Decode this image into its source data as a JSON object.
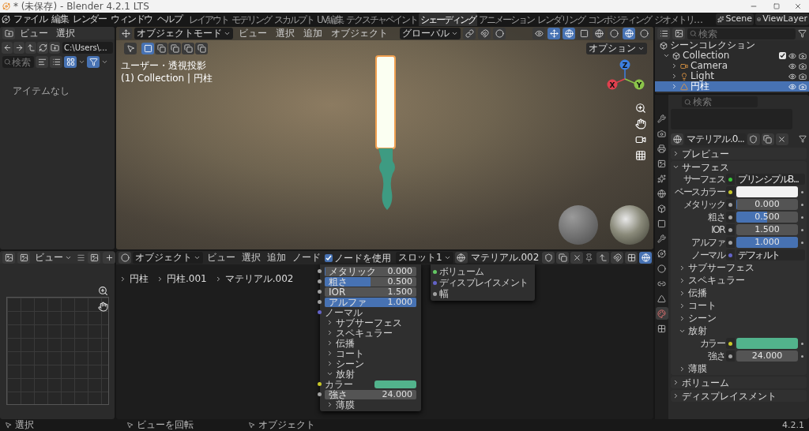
{
  "window": {
    "title": "* (未保存) - Blender 4.2.1 LTS"
  },
  "menubar": {
    "menus": [
      "ファイル",
      "編集",
      "レンダー",
      "ウィンドウ",
      "ヘルプ"
    ],
    "workspaces": [
      {
        "label": "レイアウト",
        "selected": false
      },
      {
        "label": "モデリング",
        "selected": false
      },
      {
        "label": "スカルプト",
        "selected": false
      },
      {
        "label": "UV編集",
        "selected": false
      },
      {
        "label": "テクスチャペイント",
        "selected": false
      },
      {
        "label": "シェーディング",
        "selected": true
      },
      {
        "label": "アニメーション",
        "selected": false
      },
      {
        "label": "レンダリング",
        "selected": false
      },
      {
        "label": "コンポジティング",
        "selected": false
      },
      {
        "label": "ジオメトリ…",
        "selected": false
      }
    ],
    "scene": "Scene",
    "view_layer": "ViewLayer"
  },
  "file_browser": {
    "menus": [
      "ビュー",
      "選択"
    ],
    "path": "C:\\Users\\...",
    "search_placeholder": "検索",
    "empty_text": "アイテムなし"
  },
  "viewport": {
    "mode": "オブジェクトモード",
    "menus": [
      "ビュー",
      "選択",
      "追加",
      "オブジェクト"
    ],
    "orientation": "グローバル",
    "options": "オプション",
    "view_name": "ユーザー・透視投影",
    "collection_info": "(1) Collection | 円柱",
    "gizmo_axes": [
      {
        "label": "Z",
        "color": "#3d7fe0"
      },
      {
        "label": "X",
        "color": "#e0404e"
      },
      {
        "label": "Y",
        "color": "#8bc34a"
      }
    ]
  },
  "image_editor": {
    "view_menu": "ビュー"
  },
  "node_editor": {
    "mode": "オブジェクト",
    "menus": [
      "ビュー",
      "選択",
      "追加",
      "ノード"
    ],
    "use_nodes": {
      "label": "ノードを使用",
      "checked": true
    },
    "slot": "スロット1",
    "material": "マテリアル.002",
    "breadcrumbs": [
      "円柱",
      "円柱.001",
      "マテリアル.002"
    ],
    "bsdf_rows": [
      {
        "kind": "slider",
        "label": "メタリック",
        "value": "0.000",
        "level": 0
      },
      {
        "kind": "slider",
        "label": "粗さ",
        "value": "0.500",
        "level": 0.5
      },
      {
        "kind": "number",
        "label": "IOR",
        "value": "1.500"
      },
      {
        "kind": "slider",
        "label": "アルファ",
        "value": "1.000",
        "level": 1
      },
      {
        "kind": "socket",
        "label": "ノーマル"
      },
      {
        "kind": "panel",
        "label": "サブサーフェス",
        "expanded": false
      },
      {
        "kind": "panel",
        "label": "スペキュラー",
        "expanded": false
      },
      {
        "kind": "panel",
        "label": "伝播",
        "expanded": false
      },
      {
        "kind": "panel",
        "label": "コート",
        "expanded": false
      },
      {
        "kind": "panel",
        "label": "シーン",
        "expanded": false
      },
      {
        "kind": "panel",
        "label": "放射",
        "expanded": true
      },
      {
        "kind": "color",
        "label": "カラー",
        "color": "#52b38c"
      },
      {
        "kind": "number",
        "label": "強さ",
        "value": "24.000"
      },
      {
        "kind": "panel",
        "label": "薄膜",
        "expanded": false
      }
    ],
    "output_sockets": [
      {
        "label": "ボリューム",
        "color": "#63c763"
      },
      {
        "label": "ディスプレイスメント",
        "color": "#6363c7"
      },
      {
        "label": "幅",
        "color": "#a1a1a1"
      }
    ]
  },
  "outliner": {
    "search_placeholder": "検索",
    "root": "シーンコレクション",
    "tree": [
      {
        "label": "Collection",
        "kind": "collection",
        "checked": true,
        "selected": false,
        "expanded": true,
        "children": [
          {
            "label": "Camera",
            "kind": "camera",
            "selected": false
          },
          {
            "label": "Light",
            "kind": "light",
            "selected": false
          },
          {
            "label": "円柱",
            "kind": "mesh",
            "selected": true
          }
        ]
      }
    ]
  },
  "properties": {
    "search_placeholder": "検索",
    "material": "マテリアル.0...",
    "tabs": [
      {
        "kind": "tool",
        "selected": false
      },
      {
        "kind": "render",
        "selected": false
      },
      {
        "kind": "output",
        "selected": false
      },
      {
        "kind": "view_layer",
        "selected": false
      },
      {
        "kind": "scene",
        "selected": false
      },
      {
        "kind": "world",
        "selected": false
      },
      {
        "kind": "collection",
        "selected": false
      },
      {
        "kind": "object",
        "selected": false
      },
      {
        "kind": "modifiers",
        "selected": false
      },
      {
        "kind": "particles",
        "selected": false
      },
      {
        "kind": "physics",
        "selected": false
      },
      {
        "kind": "constraints",
        "selected": false
      },
      {
        "kind": "data",
        "selected": false
      },
      {
        "kind": "material",
        "selected": true
      },
      {
        "kind": "texture",
        "selected": false
      }
    ],
    "sections": [
      {
        "label": "プレビュー",
        "expanded": false
      },
      {
        "label": "サーフェス",
        "expanded": true,
        "rows": [
          {
            "kind": "shader",
            "label": "サーフェス",
            "value": "プリンシプルB..."
          },
          {
            "kind": "color",
            "label": "ベースカラー",
            "color": "#f2f2f2"
          },
          {
            "kind": "slider",
            "label": "メタリック",
            "value": "0.000",
            "level": 0
          },
          {
            "kind": "slider",
            "label": "粗さ",
            "value": "0.500",
            "level": 0.5
          },
          {
            "kind": "number",
            "label": "IOR",
            "value": "1.500"
          },
          {
            "kind": "slider",
            "label": "アルファ",
            "value": "1.000",
            "level": 1
          },
          {
            "kind": "link",
            "label": "ノーマル",
            "value": "デフォルト"
          },
          {
            "kind": "panel",
            "label": "サブサーフェス",
            "expanded": false
          },
          {
            "kind": "panel",
            "label": "スペキュラー",
            "expanded": false
          },
          {
            "kind": "panel",
            "label": "伝播",
            "expanded": false
          },
          {
            "kind": "panel",
            "label": "コート",
            "expanded": false
          },
          {
            "kind": "panel",
            "label": "シーン",
            "expanded": false
          },
          {
            "kind": "panel",
            "label": "放射",
            "expanded": true
          },
          {
            "kind": "color",
            "label": "カラー",
            "color": "#52b38c"
          },
          {
            "kind": "number",
            "label": "強さ",
            "value": "24.000"
          },
          {
            "kind": "panel",
            "label": "薄膜",
            "expanded": false
          }
        ]
      },
      {
        "label": "ボリューム",
        "expanded": false
      },
      {
        "label": "ディスプレイスメント",
        "expanded": false
      }
    ]
  },
  "status_bar": {
    "items": [
      "選択",
      "ビューを回転",
      "オブジェクト"
    ],
    "version": "4.2.1"
  }
}
